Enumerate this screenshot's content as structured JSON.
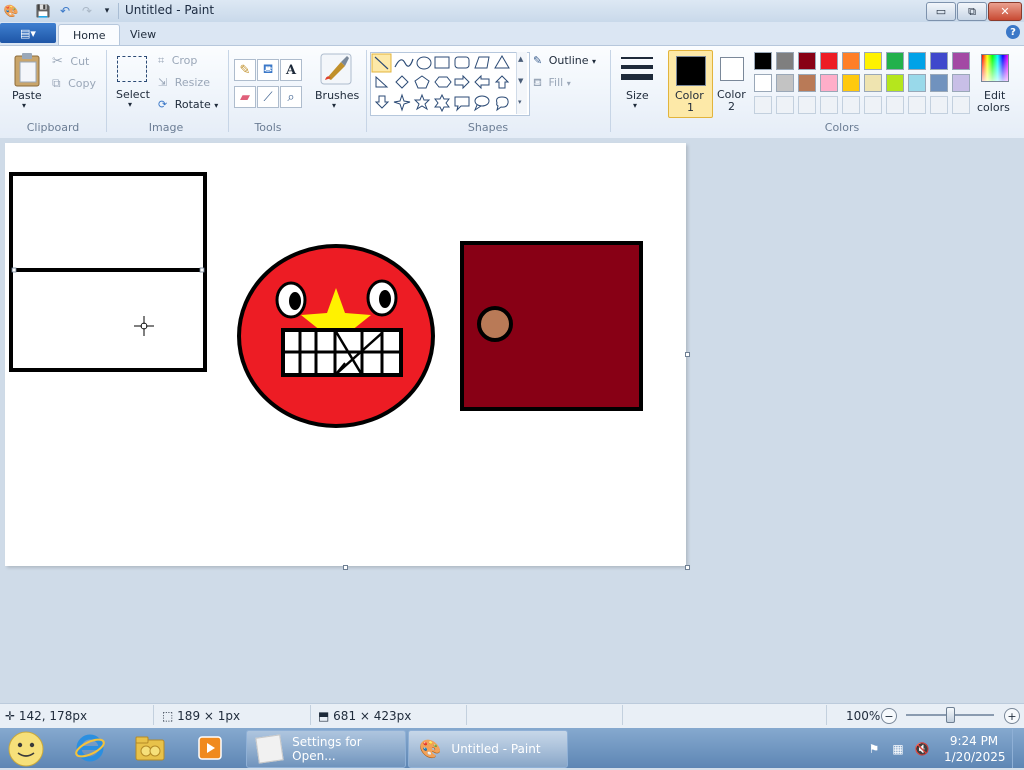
{
  "window": {
    "title": "Untitled - Paint",
    "min_glyph": "▭",
    "max_glyph": "⧉",
    "close_glyph": "✕"
  },
  "tabs": {
    "menu_glyph": "▤▾",
    "home": "Home",
    "view": "View",
    "help_glyph": "?"
  },
  "clipboard": {
    "paste": "Paste",
    "cut": "Cut",
    "copy": "Copy",
    "label": "Clipboard"
  },
  "image": {
    "select": "Select",
    "crop": "Crop",
    "resize": "Resize",
    "rotate": "Rotate",
    "label": "Image"
  },
  "tools": {
    "label": "Tools",
    "text_glyph": "A"
  },
  "brushes": {
    "label": "Brushes"
  },
  "shapes": {
    "outline": "Outline",
    "fill": "Fill",
    "label": "Shapes"
  },
  "size": {
    "label": "Size"
  },
  "color1": {
    "label": "Color",
    "num": "1",
    "value": "#000000"
  },
  "color2": {
    "label": "Color",
    "num": "2",
    "value": "#ffffff"
  },
  "edit_colors": {
    "line1": "Edit",
    "line2": "colors"
  },
  "colors_label": "Colors",
  "palette": {
    "row1": [
      "#000000",
      "#7f7f7f",
      "#880015",
      "#ed1c24",
      "#ff7f27",
      "#fff200",
      "#22b14c",
      "#00a2e8",
      "#3f48cc",
      "#a349a4"
    ],
    "row2": [
      "#ffffff",
      "#c3c3c3",
      "#b97a57",
      "#ffaec9",
      "#ffc90e",
      "#efe4b0",
      "#b5e61d",
      "#99d9ea",
      "#7092be",
      "#c8bfe7"
    ]
  },
  "drawing": {
    "face_color": "#ed1c24",
    "star_color": "#fff200",
    "door_color": "#880015",
    "knob_color": "#b97a57"
  },
  "status": {
    "cursor_pos": "142, 178px",
    "selection_size": "189 × 1px",
    "image_size": "681 × 423px",
    "zoom": "100%",
    "zoom_minus": "−",
    "zoom_plus": "+",
    "zoom_level": 0.5
  },
  "taskbar": {
    "task1": "Settings for Open...",
    "task2": "Untitled - Paint",
    "time": "9:24 PM",
    "date": "1/20/2025"
  }
}
